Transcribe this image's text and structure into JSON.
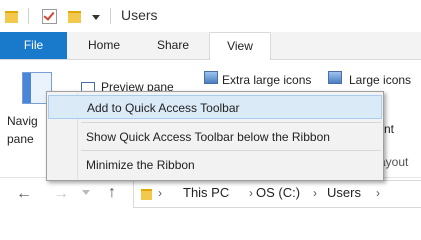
{
  "window": {
    "title": "Users"
  },
  "ribbon_tabs": [
    {
      "label": "File"
    },
    {
      "label": "Home"
    },
    {
      "label": "Share"
    },
    {
      "label": "View"
    }
  ],
  "ribbon": {
    "navigation_pane_label": "Navigation pane",
    "navigation_pane_visible": "Navig\npane",
    "preview_pane_label": "Preview pane",
    "extra_large_icons_label": "Extra large icons",
    "large_icons_label": "Large icons",
    "partial_label_nt": "nt",
    "partial_label_layout": "ayout"
  },
  "context_menu": {
    "items": [
      {
        "label": "Add to Quick Access Toolbar",
        "highlighted": true
      },
      {
        "label": "Show Quick Access Toolbar below the Ribbon"
      },
      {
        "label": "Minimize the Ribbon"
      }
    ]
  },
  "address_bar": {
    "crumbs": [
      "This PC",
      "OS (C:)",
      "Users"
    ]
  },
  "colors": {
    "file_tab": "#1979ca",
    "menu_highlight": "#dbeaf7",
    "folder": "#f2c94c"
  }
}
